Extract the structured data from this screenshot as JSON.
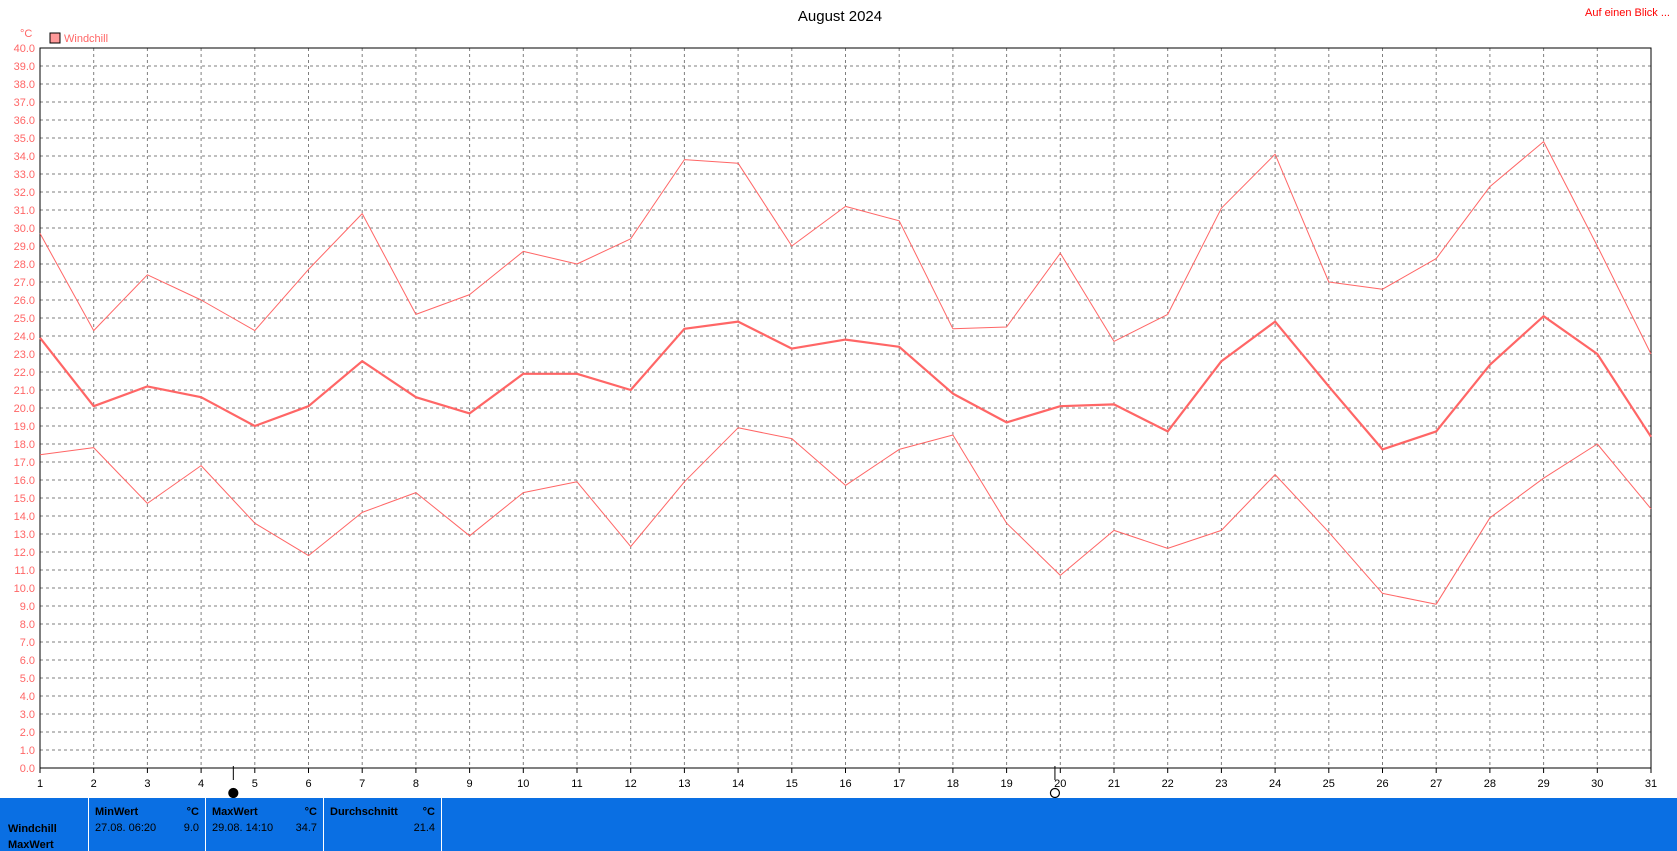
{
  "header": {
    "title": "August 2024",
    "link": "Auf einen Blick ..."
  },
  "chart_data": {
    "type": "line",
    "title": "August 2024",
    "ylabel": "°C",
    "ylim": [
      0,
      40
    ],
    "ytick_step": 1,
    "grid": true,
    "legend": {
      "entries": [
        "Windchill"
      ],
      "placement": "top-left"
    },
    "x": [
      1,
      2,
      3,
      4,
      5,
      6,
      7,
      8,
      9,
      10,
      11,
      12,
      13,
      14,
      15,
      16,
      17,
      18,
      19,
      20,
      21,
      22,
      23,
      24,
      25,
      26,
      27,
      28,
      29,
      30,
      31
    ],
    "series": [
      {
        "name": "",
        "role": "max",
        "values": [
          29.7,
          24.3,
          27.4,
          26.0,
          24.3,
          27.7,
          30.8,
          25.2,
          26.3,
          28.7,
          28.0,
          29.4,
          33.8,
          33.6,
          29.0,
          31.2,
          30.4,
          24.4,
          24.5,
          28.6,
          23.7,
          25.2,
          31.1,
          34.1,
          27.0,
          26.6,
          28.3,
          32.3,
          34.8,
          29.0,
          23.0
        ]
      },
      {
        "name": "Windchill",
        "role": "mean",
        "values": [
          23.9,
          20.1,
          21.2,
          20.6,
          19.0,
          20.1,
          22.6,
          20.6,
          19.7,
          21.9,
          21.9,
          21.0,
          24.4,
          24.8,
          23.3,
          23.8,
          23.4,
          20.8,
          19.2,
          20.1,
          20.2,
          18.7,
          22.6,
          24.8,
          21.2,
          17.7,
          18.7,
          22.4,
          25.1,
          23.0,
          18.4
        ]
      },
      {
        "name": "",
        "role": "min",
        "values": [
          17.4,
          17.8,
          14.7,
          16.8,
          13.6,
          11.8,
          14.2,
          15.3,
          12.9,
          15.3,
          15.9,
          12.3,
          15.9,
          18.9,
          18.3,
          15.7,
          17.7,
          18.5,
          13.6,
          10.7,
          13.2,
          12.2,
          13.2,
          16.3,
          13.1,
          9.7,
          9.1,
          13.9,
          16.1,
          18.0,
          14.4
        ]
      }
    ],
    "colors": {
      "line": "#ff6666",
      "grid": "#7f7f7f"
    },
    "markers": [
      {
        "x": 4.6,
        "icon": "full-moon-icon"
      },
      {
        "x": 19.9,
        "icon": "new-moon-icon"
      }
    ]
  },
  "stats": {
    "row_labels": [
      "Windchill",
      "MaxWert"
    ],
    "panels": [
      {
        "header": "MinWert",
        "unit": "°C",
        "date": "27.08.  06:20",
        "value": "9.0"
      },
      {
        "header": "MaxWert",
        "unit": "°C",
        "date": "29.08.  14:10",
        "value": "34.7"
      },
      {
        "header": "Durchschnitt",
        "unit": "°C",
        "date": "",
        "value": "21.4"
      }
    ],
    "background": "#0a6fe3"
  }
}
